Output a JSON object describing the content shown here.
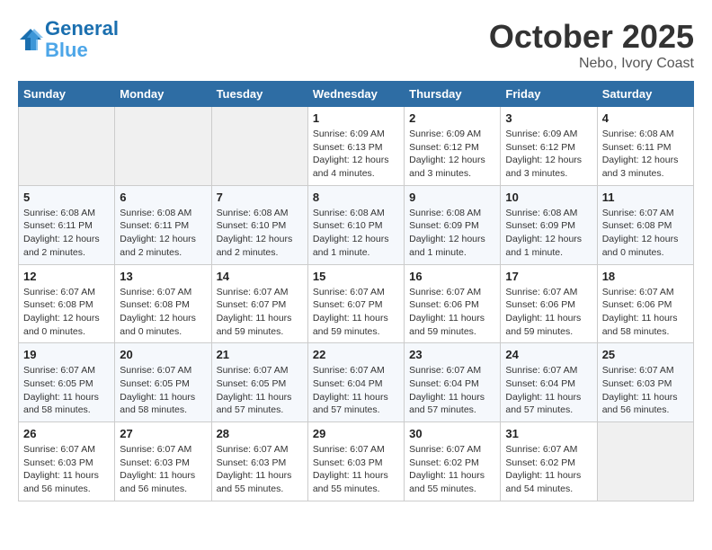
{
  "header": {
    "logo_line1": "General",
    "logo_line2": "Blue",
    "month": "October 2025",
    "location": "Nebo, Ivory Coast"
  },
  "weekdays": [
    "Sunday",
    "Monday",
    "Tuesday",
    "Wednesday",
    "Thursday",
    "Friday",
    "Saturday"
  ],
  "weeks": [
    [
      {
        "day": "",
        "empty": true
      },
      {
        "day": "",
        "empty": true
      },
      {
        "day": "",
        "empty": true
      },
      {
        "day": "1",
        "sunrise": "6:09 AM",
        "sunset": "6:13 PM",
        "daylight": "12 hours and 4 minutes."
      },
      {
        "day": "2",
        "sunrise": "6:09 AM",
        "sunset": "6:12 PM",
        "daylight": "12 hours and 3 minutes."
      },
      {
        "day": "3",
        "sunrise": "6:09 AM",
        "sunset": "6:12 PM",
        "daylight": "12 hours and 3 minutes."
      },
      {
        "day": "4",
        "sunrise": "6:08 AM",
        "sunset": "6:11 PM",
        "daylight": "12 hours and 3 minutes."
      }
    ],
    [
      {
        "day": "5",
        "sunrise": "6:08 AM",
        "sunset": "6:11 PM",
        "daylight": "12 hours and 2 minutes."
      },
      {
        "day": "6",
        "sunrise": "6:08 AM",
        "sunset": "6:11 PM",
        "daylight": "12 hours and 2 minutes."
      },
      {
        "day": "7",
        "sunrise": "6:08 AM",
        "sunset": "6:10 PM",
        "daylight": "12 hours and 2 minutes."
      },
      {
        "day": "8",
        "sunrise": "6:08 AM",
        "sunset": "6:10 PM",
        "daylight": "12 hours and 1 minute."
      },
      {
        "day": "9",
        "sunrise": "6:08 AM",
        "sunset": "6:09 PM",
        "daylight": "12 hours and 1 minute."
      },
      {
        "day": "10",
        "sunrise": "6:08 AM",
        "sunset": "6:09 PM",
        "daylight": "12 hours and 1 minute."
      },
      {
        "day": "11",
        "sunrise": "6:07 AM",
        "sunset": "6:08 PM",
        "daylight": "12 hours and 0 minutes."
      }
    ],
    [
      {
        "day": "12",
        "sunrise": "6:07 AM",
        "sunset": "6:08 PM",
        "daylight": "12 hours and 0 minutes."
      },
      {
        "day": "13",
        "sunrise": "6:07 AM",
        "sunset": "6:08 PM",
        "daylight": "12 hours and 0 minutes."
      },
      {
        "day": "14",
        "sunrise": "6:07 AM",
        "sunset": "6:07 PM",
        "daylight": "11 hours and 59 minutes."
      },
      {
        "day": "15",
        "sunrise": "6:07 AM",
        "sunset": "6:07 PM",
        "daylight": "11 hours and 59 minutes."
      },
      {
        "day": "16",
        "sunrise": "6:07 AM",
        "sunset": "6:06 PM",
        "daylight": "11 hours and 59 minutes."
      },
      {
        "day": "17",
        "sunrise": "6:07 AM",
        "sunset": "6:06 PM",
        "daylight": "11 hours and 59 minutes."
      },
      {
        "day": "18",
        "sunrise": "6:07 AM",
        "sunset": "6:06 PM",
        "daylight": "11 hours and 58 minutes."
      }
    ],
    [
      {
        "day": "19",
        "sunrise": "6:07 AM",
        "sunset": "6:05 PM",
        "daylight": "11 hours and 58 minutes."
      },
      {
        "day": "20",
        "sunrise": "6:07 AM",
        "sunset": "6:05 PM",
        "daylight": "11 hours and 58 minutes."
      },
      {
        "day": "21",
        "sunrise": "6:07 AM",
        "sunset": "6:05 PM",
        "daylight": "11 hours and 57 minutes."
      },
      {
        "day": "22",
        "sunrise": "6:07 AM",
        "sunset": "6:04 PM",
        "daylight": "11 hours and 57 minutes."
      },
      {
        "day": "23",
        "sunrise": "6:07 AM",
        "sunset": "6:04 PM",
        "daylight": "11 hours and 57 minutes."
      },
      {
        "day": "24",
        "sunrise": "6:07 AM",
        "sunset": "6:04 PM",
        "daylight": "11 hours and 57 minutes."
      },
      {
        "day": "25",
        "sunrise": "6:07 AM",
        "sunset": "6:03 PM",
        "daylight": "11 hours and 56 minutes."
      }
    ],
    [
      {
        "day": "26",
        "sunrise": "6:07 AM",
        "sunset": "6:03 PM",
        "daylight": "11 hours and 56 minutes."
      },
      {
        "day": "27",
        "sunrise": "6:07 AM",
        "sunset": "6:03 PM",
        "daylight": "11 hours and 56 minutes."
      },
      {
        "day": "28",
        "sunrise": "6:07 AM",
        "sunset": "6:03 PM",
        "daylight": "11 hours and 55 minutes."
      },
      {
        "day": "29",
        "sunrise": "6:07 AM",
        "sunset": "6:03 PM",
        "daylight": "11 hours and 55 minutes."
      },
      {
        "day": "30",
        "sunrise": "6:07 AM",
        "sunset": "6:02 PM",
        "daylight": "11 hours and 55 minutes."
      },
      {
        "day": "31",
        "sunrise": "6:07 AM",
        "sunset": "6:02 PM",
        "daylight": "11 hours and 54 minutes."
      },
      {
        "day": "",
        "empty": true
      }
    ]
  ]
}
